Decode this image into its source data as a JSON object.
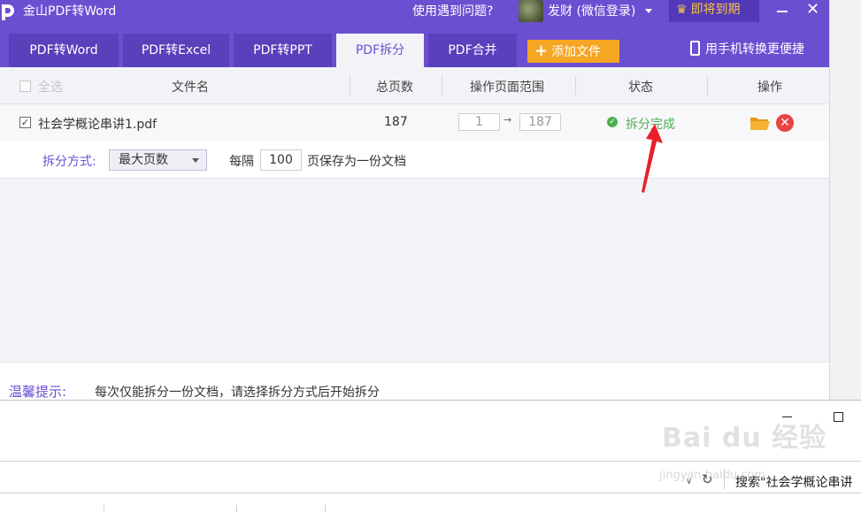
{
  "titlebar": {
    "app_title": "金山PDF转Word",
    "help_text": "使用遇到问题?",
    "user_name": "发财 (微信登录)",
    "vip_label": "即将到期",
    "close_glyph": "✕"
  },
  "tabs": [
    {
      "label": "PDF转Word",
      "active": false
    },
    {
      "label": "PDF转Excel",
      "active": false
    },
    {
      "label": "PDF转PPT",
      "active": false
    },
    {
      "label": "PDF拆分",
      "active": true
    },
    {
      "label": "PDF合并",
      "active": false
    }
  ],
  "toolbar": {
    "add_file_label": "添加文件",
    "phone_convert_label": "用手机转换更便捷"
  },
  "table": {
    "select_all": "全选",
    "columns": [
      "文件名",
      "总页数",
      "操作页面范围",
      "状态",
      "操作"
    ],
    "rows": [
      {
        "checked": true,
        "file_name": "社会学概论串讲1.pdf",
        "total_pages": "187",
        "range_from": "1",
        "range_to": "187",
        "status": "拆分完成"
      }
    ]
  },
  "split": {
    "mode_label": "拆分方式:",
    "mode_value": "最大页数",
    "every_label": "每隔",
    "every_value": "100",
    "suffix_label": "页保存为一份文档"
  },
  "tip": {
    "label": "温馨提示:",
    "text": "每次仅能拆分一份文档，请选择拆分方式后开始拆分"
  },
  "bottom_window": {
    "search_text": "搜索\"社会学概论串讲"
  },
  "watermark": {
    "text": "Bai du 经验",
    "sub": "jingyan.baidu.com"
  },
  "colors": {
    "brand_purple": "#6b4fd1",
    "add_button_orange": "#f5a623",
    "status_green": "#4caf50",
    "delete_red": "#e84343",
    "annotation_red": "#e8202a"
  },
  "icons": [
    "app-logo-icon",
    "avatar",
    "crown-icon",
    "plus-icon",
    "phone-icon",
    "check-circle-icon",
    "folder-icon",
    "delete-icon",
    "refresh-icon",
    "chevron-down-icon"
  ]
}
